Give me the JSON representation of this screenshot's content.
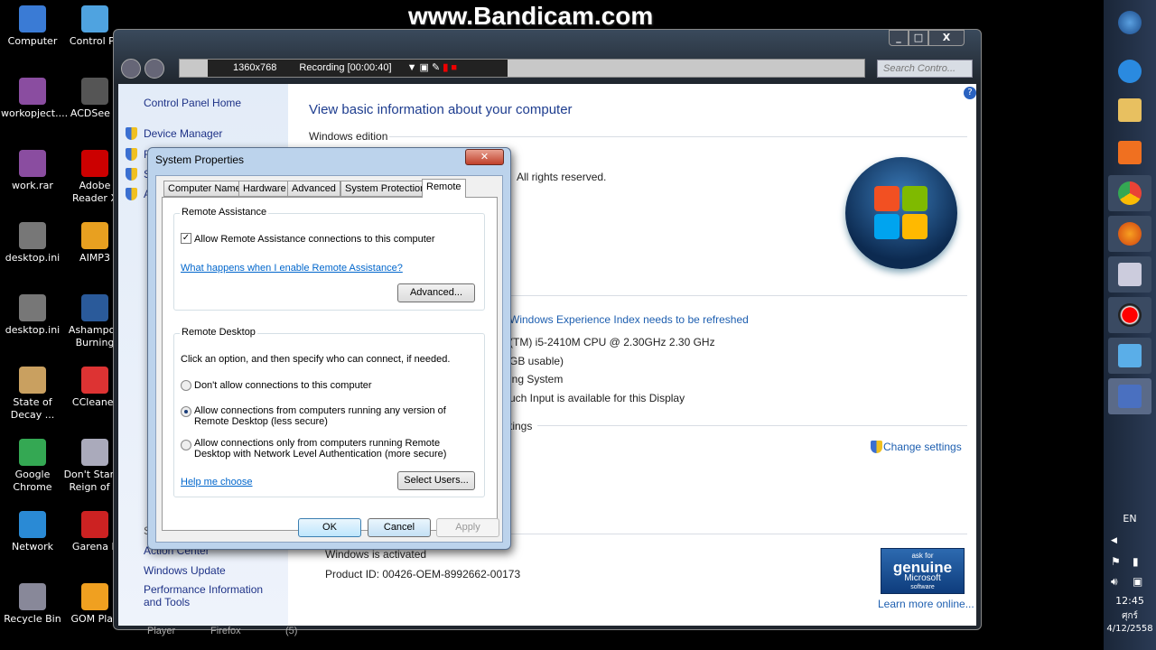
{
  "watermark": "www.Bandicam.com",
  "desktop": {
    "icons": [
      {
        "label": "Computer",
        "color": "#3a7bd5"
      },
      {
        "label": "Control Pa",
        "color": "#4fa3e0"
      },
      {
        "label": "workopject....",
        "color": "#8a4da0"
      },
      {
        "label": "ACDSee P",
        "color": "#555"
      },
      {
        "label": "work.rar",
        "color": "#8a4da0"
      },
      {
        "label": "Adobe Reader X",
        "color": "#c00"
      },
      {
        "label": "desktop.ini",
        "color": "#777"
      },
      {
        "label": "AIMP3",
        "color": "#e8a020"
      },
      {
        "label": "desktop.ini",
        "color": "#777"
      },
      {
        "label": "Ashampoo Burning",
        "color": "#2a5a9a"
      },
      {
        "label": "State of Decay ...",
        "color": "#c9a060"
      },
      {
        "label": "CCleaner",
        "color": "#d33"
      },
      {
        "label": "Google Chrome",
        "color": "#34a853"
      },
      {
        "label": "Don't Starve Reign of G",
        "color": "#aab"
      },
      {
        "label": "Network",
        "color": "#2a8ad5"
      },
      {
        "label": "Garena P",
        "color": "#c22"
      },
      {
        "label": "Recycle Bin",
        "color": "#889"
      },
      {
        "label": "GOM Play",
        "color": "#f0a020"
      }
    ]
  },
  "bandicam": {
    "resolution": "1360x768",
    "recording": "Recording [00:00:40]"
  },
  "explorer": {
    "search_placeholder": "Search Contro...",
    "left": {
      "home": "Control Panel Home",
      "items": [
        "Device Manager",
        "R",
        "S",
        "A"
      ],
      "see_also": "S",
      "bottom": [
        "Action Center",
        "Windows Update",
        "Performance Information and Tools"
      ]
    },
    "title": "View basic information about your computer",
    "section_edition": "Windows edition",
    "rights": "All rights reserved.",
    "wei": "Windows Experience Index needs to be refreshed",
    "cpu": "(TM) i5-2410M CPU @ 2.30GHz   2.30 GHz",
    "ram": "GB usable)",
    "systype": "ing System",
    "touch": "uch Input is available for this Display",
    "settings": "tings",
    "change_settings": "Change settings",
    "activation": "Windows is activated",
    "product_id": "Product ID:  00426-OEM-8992662-00173",
    "genuine": {
      "line1": "ask for",
      "line2": "genuine",
      "line3": "Microsoft",
      "line4": "software"
    },
    "learn_more": "Learn more online..."
  },
  "dialog": {
    "title": "System Properties",
    "tabs": [
      "Computer Name",
      "Hardware",
      "Advanced",
      "System Protection",
      "Remote"
    ],
    "active_tab": "Remote",
    "ra": {
      "title": "Remote Assistance",
      "checkbox": "Allow Remote Assistance connections to this computer",
      "checked": true,
      "link": "What happens when I enable Remote Assistance?",
      "advanced": "Advanced..."
    },
    "rd": {
      "title": "Remote Desktop",
      "intro": "Click an option, and then specify who can connect, if needed.",
      "opt1": "Don't allow connections to this computer",
      "opt2a": "Allow connections from computers running any version of",
      "opt2b": "Remote Desktop (less secure)",
      "opt3a": "Allow connections only from computers running Remote",
      "opt3b": "Desktop with Network Level Authentication (more secure)",
      "selected": 2,
      "help": "Help me choose",
      "select_users": "Select Users..."
    },
    "ok": "OK",
    "cancel": "Cancel",
    "apply": "Apply"
  },
  "taskbar_labels": [
    "Player",
    "Firefox",
    "(5)"
  ],
  "tray": {
    "lang": "EN",
    "time": "12:45",
    "day": "ศุกร์",
    "date": "4/12/2558"
  }
}
